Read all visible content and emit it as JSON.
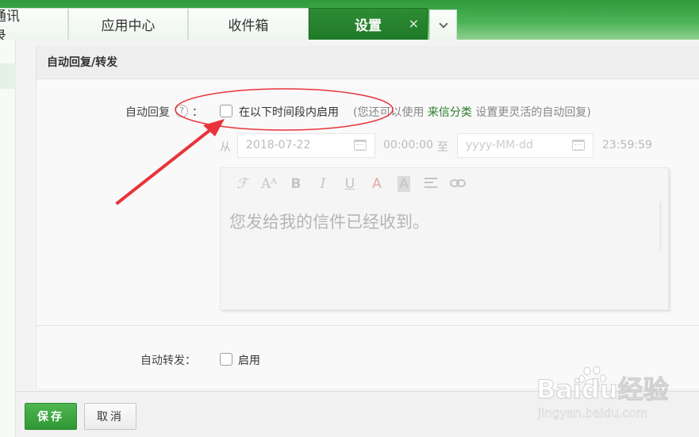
{
  "tabs": {
    "contacts": "通讯录",
    "apps": "应用中心",
    "inbox": "收件箱",
    "settings": "设置",
    "close": "×"
  },
  "panel": {
    "title": "自动回复/转发"
  },
  "auto_reply": {
    "label": "自动回复",
    "help": "?",
    "colon": "：",
    "enable_label": "在以下时间段内启用",
    "hint_prefix": "(您还可以使用 ",
    "hint_link": "来信分类",
    "hint_suffix": " 设置更灵活的自动回复)",
    "checked": false
  },
  "schedule": {
    "from_label": "从",
    "start_date": "2018-07-22",
    "start_time": "00:00:00",
    "to_label": "至",
    "end_date_placeholder": "yyyy-MM-dd",
    "end_time": "23:59:59"
  },
  "editor": {
    "toolbar": {
      "font": "ℱ",
      "size": "Aᴬ",
      "bold": "B",
      "italic": "I",
      "underline": "U",
      "font_color": "A",
      "bg_color": "A"
    },
    "content": "您发给我的信件已经收到。"
  },
  "auto_forward": {
    "label": "自动转发：",
    "enable_label": "启用",
    "checked": false
  },
  "footer": {
    "save": "保存",
    "cancel": "取消"
  },
  "watermark": {
    "logo": "Baidu经验",
    "url": "jingyan.baidu.com"
  },
  "colors": {
    "accent": "#2e8c35",
    "link": "#2b7b2b",
    "annotation": "#e8343a"
  }
}
